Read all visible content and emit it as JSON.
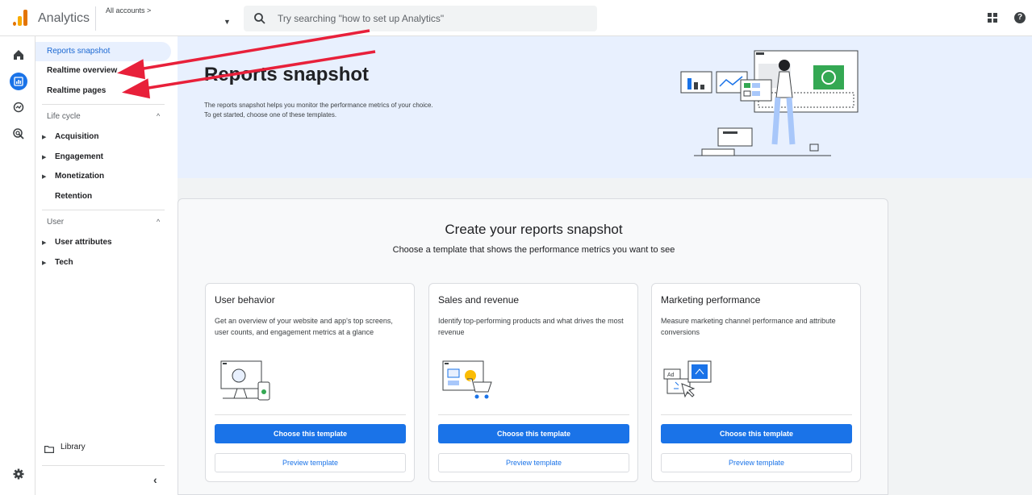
{
  "header": {
    "app_title": "Analytics",
    "accounts_label": "All accounts >",
    "search_placeholder": "Try searching \"how to set up Analytics\""
  },
  "sidebar": {
    "items": [
      {
        "label": "Reports snapshot",
        "selected": true
      },
      {
        "label": "Realtime overview"
      },
      {
        "label": "Realtime pages"
      }
    ],
    "lifecycle": {
      "label": "Life cycle",
      "items": [
        "Acquisition",
        "Engagement",
        "Monetization",
        "Retention"
      ]
    },
    "user": {
      "label": "User",
      "items": [
        "User attributes",
        "Tech"
      ]
    },
    "library_label": "Library"
  },
  "banner": {
    "title": "Reports snapshot",
    "desc_line1": "The reports snapshot helps you monitor the performance metrics of your choice.",
    "desc_line2": "To get started, choose one of these templates."
  },
  "panel": {
    "title": "Create your reports snapshot",
    "subtitle": "Choose a template that shows the performance metrics you want to see"
  },
  "cards": [
    {
      "title": "User behavior",
      "desc": "Get an overview of your website and app's top screens, user counts, and engagement metrics at a glance",
      "choose": "Choose this template",
      "preview": "Preview template"
    },
    {
      "title": "Sales and revenue",
      "desc": "Identify top-performing products and what drives the most revenue",
      "choose": "Choose this template",
      "preview": "Preview template"
    },
    {
      "title": "Marketing performance",
      "desc": "Measure marketing channel performance and attribute conversions",
      "choose": "Choose this template",
      "preview": "Preview template"
    }
  ],
  "illustrations": {
    "ad_label": "Ad"
  },
  "colors": {
    "accent": "#1a73e8",
    "annotation_arrow": "#e8203a",
    "banner_bg": "#e8f0fe"
  }
}
